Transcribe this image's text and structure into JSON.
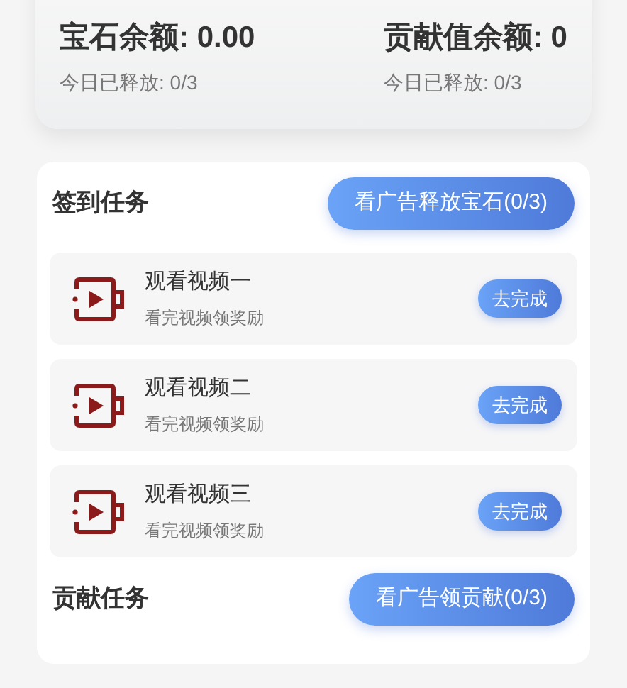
{
  "balances": [
    {
      "label": "宝石余额: 0.00",
      "released": "今日已释放: 0/3"
    },
    {
      "label": "贡献值余额: 0",
      "released": "今日已释放: 0/3"
    }
  ],
  "signin_tasks": {
    "title": "签到任务",
    "action": "看广告释放宝石(0/3)",
    "items": [
      {
        "title": "观看视频一",
        "subtitle": "看完视频领奖励",
        "button": "去完成"
      },
      {
        "title": "观看视频二",
        "subtitle": "看完视频领奖励",
        "button": "去完成"
      },
      {
        "title": "观看视频三",
        "subtitle": "看完视频领奖励",
        "button": "去完成"
      }
    ]
  },
  "contribution_tasks": {
    "title": "贡献任务",
    "action": "看广告领贡献(0/3)"
  }
}
